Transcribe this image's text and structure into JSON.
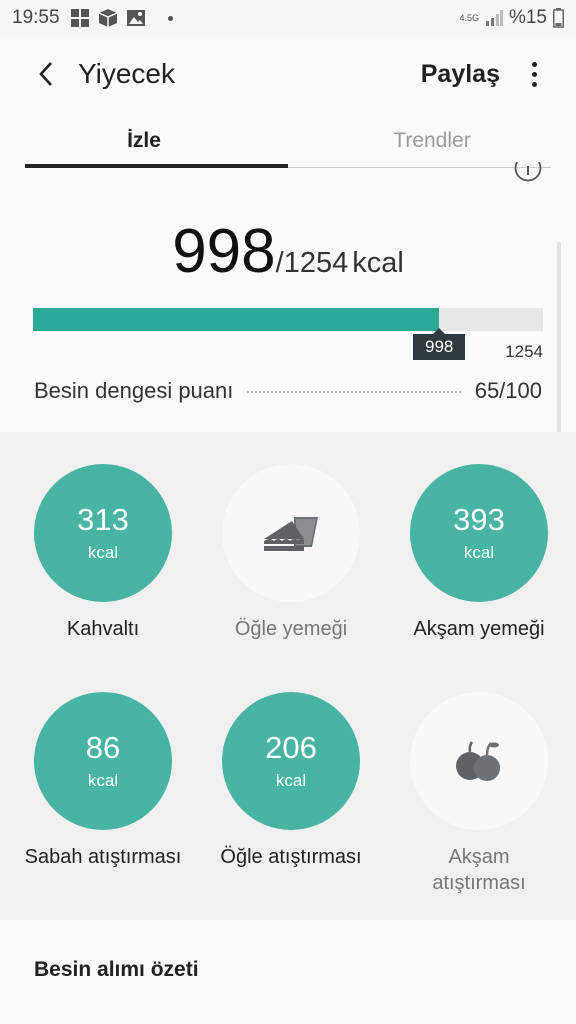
{
  "status": {
    "time": "19:55",
    "network": "4.5G",
    "battery": "%15"
  },
  "appbar": {
    "title": "Yiyecek",
    "share": "Paylaş"
  },
  "tabs": [
    {
      "label": "İzle"
    },
    {
      "label": "Trendler"
    }
  ],
  "summary": {
    "consumed": "998",
    "target_text": "/1254",
    "unit": "kcal",
    "progress": {
      "value": 998,
      "max": 1254,
      "badge": "998",
      "max_label": "1254"
    },
    "balance_label": "Besin dengesi puanı",
    "balance_value": "65/100"
  },
  "meals": [
    {
      "value": "313",
      "unit": "kcal",
      "label": "Kahvaltı",
      "filled": true
    },
    {
      "icon": "sandwich-icon",
      "label": "Öğle yemeği",
      "filled": false
    },
    {
      "value": "393",
      "unit": "kcal",
      "label": "Akşam yemeği",
      "filled": true
    },
    {
      "value": "86",
      "unit": "kcal",
      "label": "Sabah atıştırması",
      "filled": true
    },
    {
      "value": "206",
      "unit": "kcal",
      "label": "Öğle atıştırması",
      "filled": true
    },
    {
      "icon": "fruit-icon",
      "label": "Akşam atıştırması",
      "filled": false
    }
  ],
  "intake": {
    "title": "Besin alımı özeti"
  },
  "colors": {
    "accent": "#48b5a4",
    "progress": "#2ba896",
    "badge": "#2f3a40"
  }
}
